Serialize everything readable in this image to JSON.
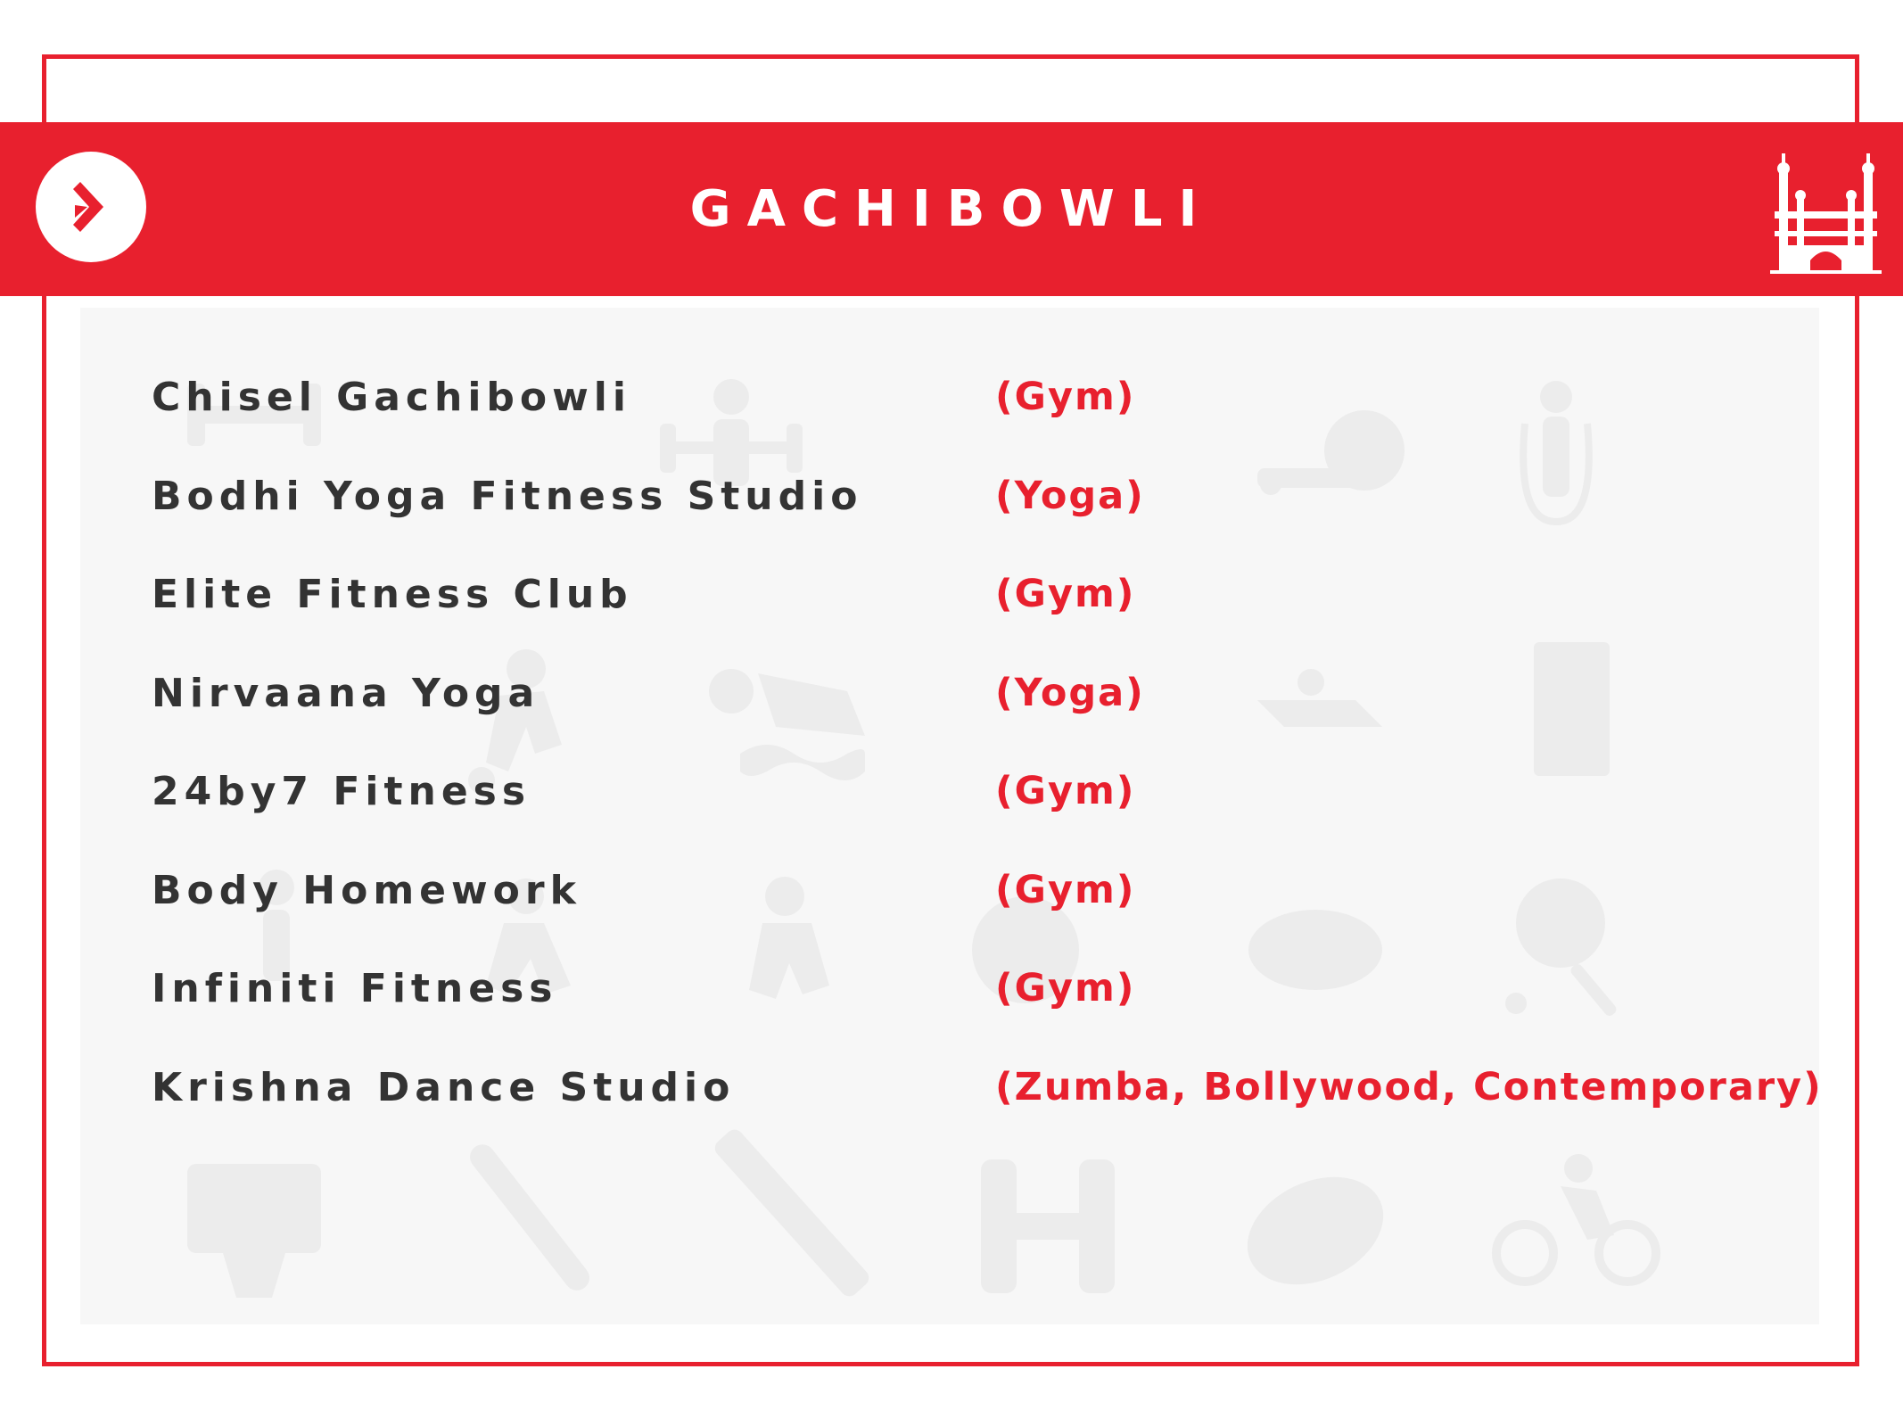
{
  "header": {
    "title": "GACHIBOWLI",
    "logo_icon": "arrow-logo-icon",
    "landmark_icon": "charminar-icon"
  },
  "colors": {
    "accent": "#e8202e",
    "text": "#333333",
    "background": "#ffffff"
  },
  "listings": [
    {
      "name": "Chisel Gachibowli",
      "category": "(Gym)"
    },
    {
      "name": "Bodhi Yoga Fitness Studio",
      "category": "(Yoga)"
    },
    {
      "name": "Elite Fitness Club",
      "category": "(Gym)"
    },
    {
      "name": "Nirvaana Yoga",
      "category": "(Yoga)"
    },
    {
      "name": "24by7 Fitness",
      "category": "(Gym)"
    },
    {
      "name": "Body Homework",
      "category": "(Gym)"
    },
    {
      "name": "Infiniti Fitness",
      "category": "(Gym)"
    },
    {
      "name": "Krishna Dance Studio",
      "category": "(Zumba, Bollywood, Contemporary)"
    }
  ],
  "background_icons": [
    "weightlifting-icon",
    "skipping-rope-icon",
    "swimming-icon",
    "running-icon",
    "football-icon",
    "table-tennis-icon",
    "basketball-hoop-icon",
    "baseball-bat-icon",
    "cricket-bat-icon",
    "dumbbell-icon",
    "rugby-ball-icon",
    "cycling-icon"
  ]
}
